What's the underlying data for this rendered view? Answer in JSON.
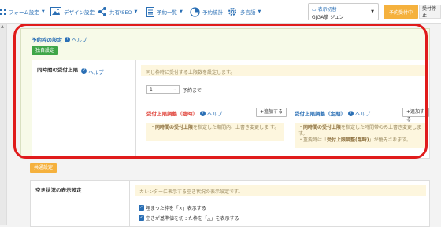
{
  "nav": {
    "items": [
      {
        "label": "フォーム設定",
        "icon": "grid-icon"
      },
      {
        "label": "デザイン設定",
        "icon": "image-icon"
      },
      {
        "label": "共有/SEO",
        "icon": "share-icon"
      },
      {
        "label": "予約一覧",
        "icon": "document-icon"
      },
      {
        "label": "予約統計",
        "icon": "pie-chart-icon"
      },
      {
        "label": "多言語",
        "icon": "gear-icon"
      }
    ],
    "user_label": "表示切替",
    "user_name": "GJGA拳 ジュン",
    "accept_button": "予約受付中",
    "stop_button": "受付停止"
  },
  "reservation": {
    "title": "予約枠の設定",
    "help": "ヘルプ",
    "independent_button": "独自設定",
    "concurrent_label": "同時間の受付上限",
    "concurrent_help": "ヘルプ",
    "concurrent_note": "同じ枠時に受付する上限数を設定します。",
    "select_value": "1",
    "select_suffix": "予約まで",
    "temp": {
      "title": "受付上限調整（臨時）",
      "help": "ヘルプ",
      "add": "+追加する",
      "note_prefix": "・",
      "note_bold": "同時間の受付上限",
      "note_rest": "を指定した期間内、上書き変更しま す。"
    },
    "regular": {
      "title": "受付上限調整（定期）",
      "help": "ヘルプ",
      "add": "+追加する",
      "note_prefix": "・",
      "note_bold": "同時間の受付上限",
      "note_rest": "を指定した時間帯のみ上書き変更しま す。",
      "note2_prefix": "・重要時は「",
      "note2_bold": "受付上限調整(臨時)",
      "note2_rest": "」が優先されます。"
    }
  },
  "common": {
    "button": "共通設定",
    "availability_label": "空き状況の表示設定",
    "availability_note": "カレンダーに表示する空き状況の表示設定です。",
    "check1": "埋まった枠を「×」表示する",
    "check2": "空きが基準値を切った枠を「△」を表示する"
  }
}
